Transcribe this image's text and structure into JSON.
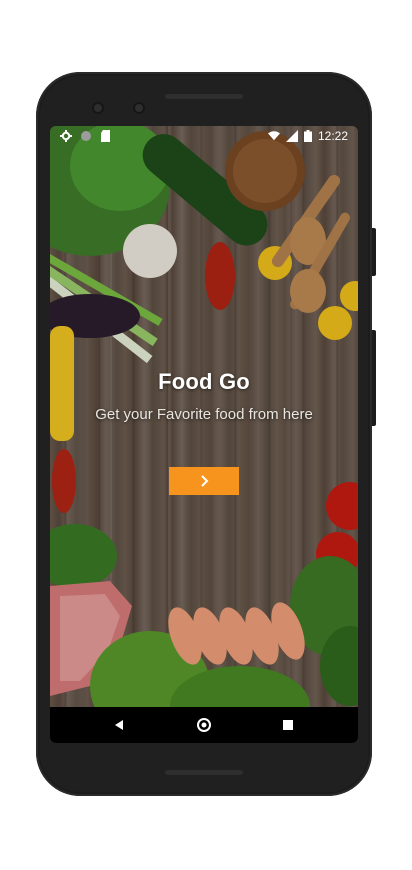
{
  "status_bar": {
    "time": "12:22",
    "icons_left": [
      "gear-icon",
      "circle-icon",
      "sd-card-icon"
    ],
    "icons_right": [
      "wifi-icon",
      "signal-icon",
      "battery-icon"
    ]
  },
  "app": {
    "title": "Food Go",
    "subtitle": "Get your Favorite food from here",
    "next_button_icon": "chevron-right-icon",
    "accent_color": "#f7941d"
  },
  "nav_bar": {
    "buttons": [
      "back-icon",
      "home-icon",
      "recents-icon"
    ]
  }
}
